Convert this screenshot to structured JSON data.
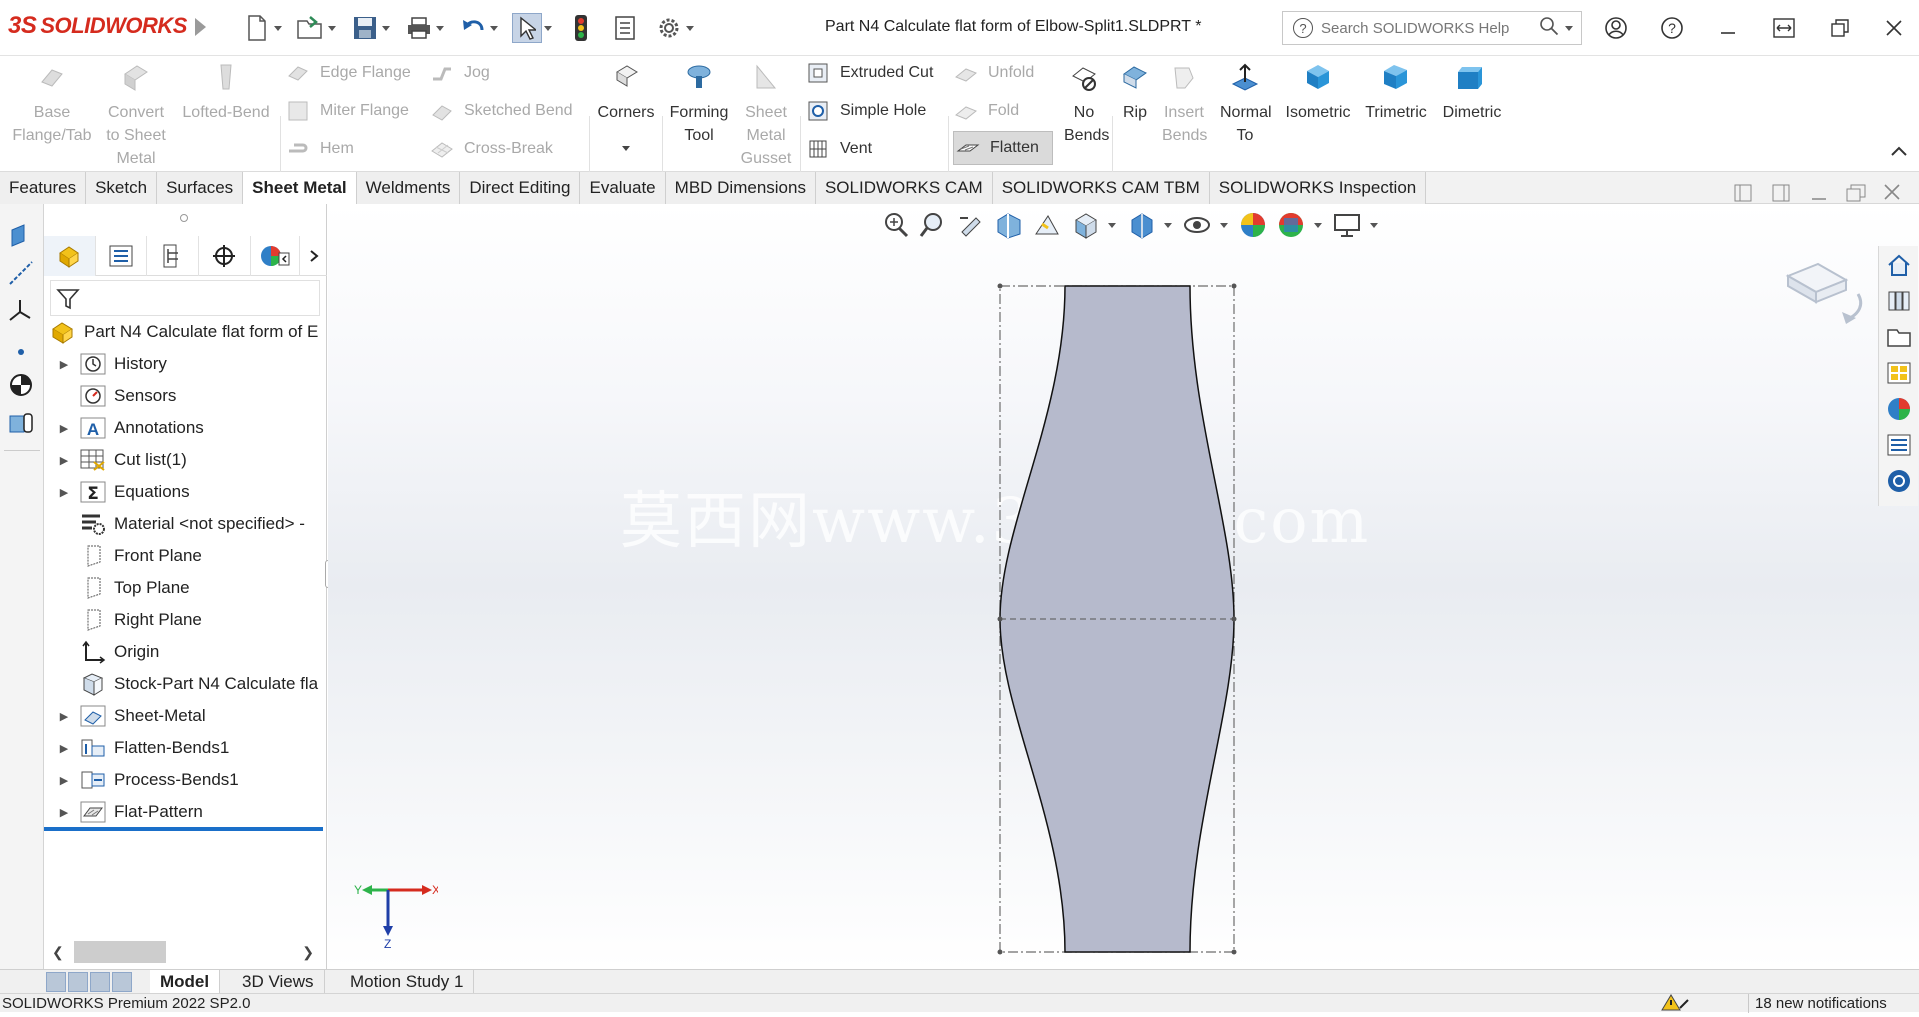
{
  "app": {
    "logo_text": "SOLIDWORKS",
    "document_title": "Part N4 Calculate flat form of Elbow-Split1.SLDPRT *",
    "search_placeholder": "Search SOLIDWORKS Help"
  },
  "ribbon": {
    "base_flange": "Base Flange/Tab",
    "convert": "Convert to Sheet Metal",
    "lofted_bend": "Lofted-Bend",
    "edge_flange": "Edge Flange",
    "miter_flange": "Miter Flange",
    "hem": "Hem",
    "jog": "Jog",
    "sketched_bend": "Sketched Bend",
    "cross_break": "Cross-Break",
    "corners": "Corners",
    "forming_tool": "Forming Tool",
    "sheet_metal_gusset": "Sheet Metal Gusset",
    "extruded_cut": "Extruded Cut",
    "simple_hole": "Simple Hole",
    "vent": "Vent",
    "unfold": "Unfold",
    "fold": "Fold",
    "flatten": "Flatten",
    "no_bends": "No Bends",
    "rip": "Rip",
    "insert_bends": "Insert Bends",
    "normal_to": "Normal To",
    "isometric": "Isometric",
    "trimetric": "Trimetric",
    "dimetric": "Dimetric"
  },
  "tabs": [
    "Features",
    "Sketch",
    "Surfaces",
    "Sheet Metal",
    "Weldments",
    "Direct Editing",
    "Evaluate",
    "MBD Dimensions",
    "SOLIDWORKS CAM",
    "SOLIDWORKS CAM TBM",
    "SOLIDWORKS Inspection"
  ],
  "tree": {
    "root": "Part N4 Calculate flat form of E",
    "items": [
      {
        "label": "History"
      },
      {
        "label": "Sensors"
      },
      {
        "label": "Annotations"
      },
      {
        "label": "Cut list(1)"
      },
      {
        "label": "Equations"
      },
      {
        "label": "Material <not specified> -"
      },
      {
        "label": "Front Plane"
      },
      {
        "label": "Top Plane"
      },
      {
        "label": "Right Plane"
      },
      {
        "label": "Origin"
      },
      {
        "label": "Stock-Part N4 Calculate fla"
      },
      {
        "label": "Sheet-Metal"
      },
      {
        "label": "Flatten-Bends1"
      },
      {
        "label": "Process-Bends1"
      },
      {
        "label": "Flat-Pattern"
      }
    ]
  },
  "triad": {
    "x": "X",
    "y": "Y",
    "z": "Z"
  },
  "watermark": "莫西网www.3dmox.com",
  "bottom_tabs": [
    "Model",
    "3D Views",
    "Motion Study 1"
  ],
  "status": {
    "version": "SOLIDWORKS Premium 2022 SP2.0",
    "notifications": "18 new notifications"
  },
  "colors": {
    "brand": "#d52b1e",
    "part_fill": "#b6bacc",
    "selection": "#1a6fc9"
  }
}
